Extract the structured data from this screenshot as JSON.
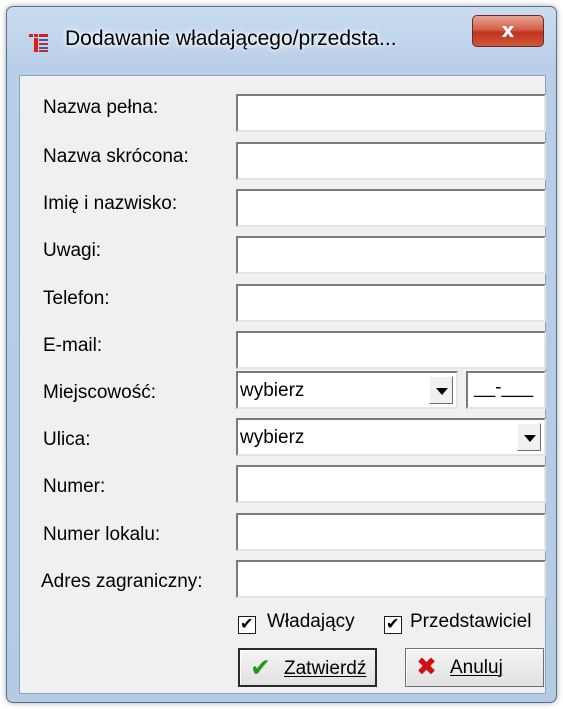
{
  "window": {
    "title": "Dodawanie władającego/przedsta...",
    "close_symbol": "x"
  },
  "form": {
    "fields": [
      {
        "label": "Nazwa pełna:",
        "value": ""
      },
      {
        "label": "Nazwa skrócona:",
        "value": ""
      },
      {
        "label": "Imię i nazwisko:",
        "value": ""
      },
      {
        "label": "Uwagi:",
        "value": ""
      },
      {
        "label": "Telefon:",
        "value": ""
      },
      {
        "label": "E-mail:",
        "value": ""
      },
      {
        "label": "Miejscowość:",
        "value": "wybierz"
      },
      {
        "label": "Ulica:",
        "value": "wybierz"
      },
      {
        "label": "Numer:",
        "value": ""
      },
      {
        "label": "Numer lokalu:",
        "value": ""
      },
      {
        "label": "Adres zagraniczny:",
        "value": ""
      }
    ],
    "postal_code": "__-___"
  },
  "checkboxes": {
    "wladajacy": {
      "label": "Władający",
      "checked": true
    },
    "przedstawiciel": {
      "label": "Przedstawiciel",
      "checked": true
    }
  },
  "buttons": {
    "confirm": {
      "label": "Zatwierdź",
      "icon": "checkmark-icon",
      "icon_color": "#1f9a1f"
    },
    "cancel": {
      "label": "Anuluj",
      "icon": "x-icon",
      "icon_color": "#d01010"
    }
  }
}
